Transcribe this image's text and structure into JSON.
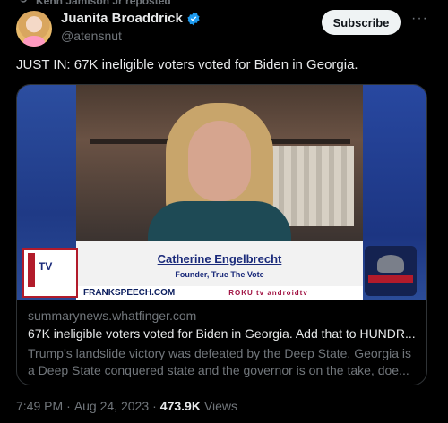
{
  "repost": {
    "icon": "repost-icon",
    "text": "Kenn Jamison Jr reposted"
  },
  "author": {
    "name": "Juanita Broaddrick",
    "handle": "@atensnut",
    "verified": true
  },
  "actions": {
    "subscribe_label": "Subscribe",
    "more_label": "···"
  },
  "tweet": {
    "text": "JUST IN: 67K ineligible voters voted for Biden in Georgia."
  },
  "media": {
    "lower_third_name": "Catherine Engelbrecht",
    "lower_third_title": "Founder, True The Vote",
    "ticker_site": "FRANKSPEECH.COM",
    "ticker_apps": "ROKU  tv  androidtv",
    "left_logo_text": "TV"
  },
  "card": {
    "domain": "summarynews.whatfinger.com",
    "title": "67K ineligible voters voted for Biden in Georgia. Add that to HUNDR...",
    "description": "Trump’s landslide victory was defeated by the Deep State. Georgia is a Deep State conquered state and the governor is on the take, doe..."
  },
  "meta": {
    "time": "7:49 PM",
    "sep": "·",
    "date": "Aug 24, 2023",
    "sep2": "·",
    "views_count": "473.9K",
    "views_label": "Views"
  },
  "colors": {
    "accent_blue": "#1d9bf0",
    "text": "#e7e9ea",
    "muted": "#71767b",
    "border": "#2f3336"
  }
}
